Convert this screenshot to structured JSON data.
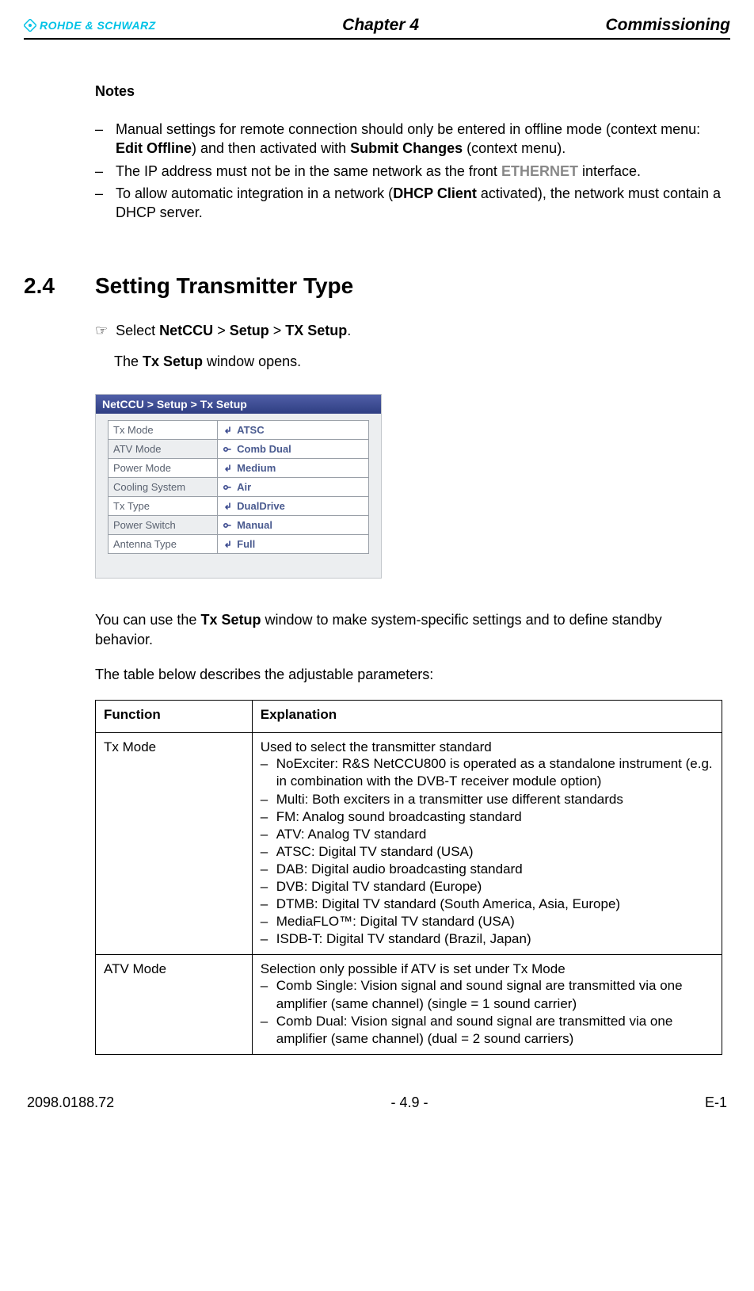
{
  "header": {
    "brand": "ROHDE & SCHWARZ",
    "chapter": "Chapter 4",
    "title": "Commissioning"
  },
  "notes": {
    "heading": "Notes",
    "items": [
      {
        "pre": "Manual settings for remote connection should only be entered in offline mode (context menu: ",
        "b1": "Edit Offline",
        "mid": ") and then activated with ",
        "b2": "Submit Changes",
        "post": " (context menu)."
      },
      {
        "pre": "The IP address must not be in the same network as the front ",
        "caps": "ETHERNET",
        "post": " interface."
      },
      {
        "pre": "To allow automatic integration in a network (",
        "b1": "DHCP Client",
        "post": " activated), the network must contain a DHCP server."
      }
    ]
  },
  "section": {
    "num": "2.4",
    "title": "Setting Transmitter Type"
  },
  "step": {
    "pre": "Select ",
    "b1": "NetCCU",
    "gt1": " > ",
    "b2": "Setup",
    "gt2": " > ",
    "b3": "TX Setup",
    "post": ".",
    "result_pre": "The ",
    "result_b": "Tx Setup",
    "result_post": " window opens."
  },
  "screenshot": {
    "breadcrumb": "NetCCU  > Setup > Tx Setup",
    "rows": [
      {
        "label": "Tx Mode",
        "value": "ATSC",
        "icon": "enter"
      },
      {
        "label": "ATV Mode",
        "value": "Comb Dual",
        "icon": "lock"
      },
      {
        "label": "Power Mode",
        "value": "Medium",
        "icon": "enter"
      },
      {
        "label": "Cooling System",
        "value": "Air",
        "icon": "lock"
      },
      {
        "label": "Tx Type",
        "value": "DualDrive",
        "icon": "enter"
      },
      {
        "label": "Power Switch",
        "value": "Manual",
        "icon": "lock"
      },
      {
        "label": "Antenna Type",
        "value": "Full",
        "icon": "enter"
      }
    ]
  },
  "body": {
    "p1_pre": "You can use the ",
    "p1_b": "Tx Setup",
    "p1_post": " window to make system-specific settings and to define standby behavior.",
    "p2": "The table below describes the adjustable parameters:"
  },
  "param_table": {
    "head_func": "Function",
    "head_exp": "Explanation",
    "rows": [
      {
        "func": "Tx Mode",
        "intro": "Used to select the transmitter standard",
        "items": [
          "NoExciter: R&S NetCCU800 is operated as a standalone instrument (e.g. in combination with the DVB-T receiver module option)",
          "Multi: Both exciters in a transmitter use different standards",
          "FM: Analog sound broadcasting standard",
          "ATV: Analog TV standard",
          "ATSC: Digital TV standard (USA)",
          "DAB: Digital audio broadcasting standard",
          "DVB: Digital TV standard (Europe)",
          "DTMB: Digital TV standard (South America, Asia, Europe)",
          "MediaFLO™: Digital TV standard (USA)",
          "ISDB-T: Digital TV standard (Brazil, Japan)"
        ]
      },
      {
        "func": "ATV Mode",
        "intro": "Selection only possible if ATV is set under Tx Mode",
        "items": [
          "Comb Single: Vision signal and sound signal are transmitted via one amplifier (same channel) (single = 1 sound carrier)",
          "Comb Dual: Vision signal and sound signal are transmitted via one amplifier (same channel) (dual = 2 sound carriers)"
        ]
      }
    ]
  },
  "footer": {
    "left": "2098.0188.72",
    "center": "- 4.9 -",
    "right": "E-1"
  }
}
